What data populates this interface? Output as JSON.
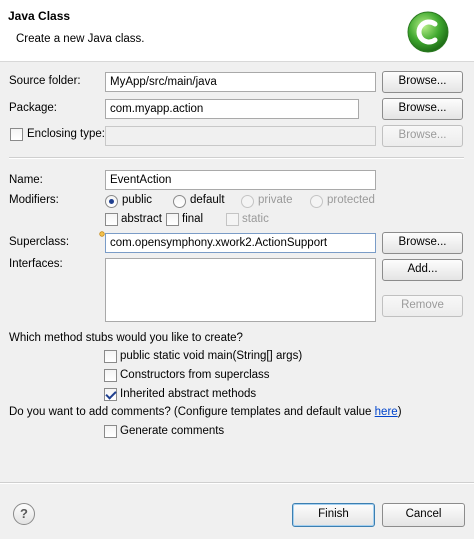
{
  "header": {
    "title": "Java Class",
    "description": "Create a new Java class."
  },
  "source_folder": {
    "label": "Source folder:",
    "value": "MyApp/src/main/java",
    "browse_label": "Browse..."
  },
  "package": {
    "label": "Package:",
    "value": "com.myapp.action",
    "browse_label": "Browse..."
  },
  "enclosing_type": {
    "label": "Enclosing type:",
    "value": "",
    "browse_label": "Browse...",
    "checked": false
  },
  "name": {
    "label": "Name:",
    "value": "EventAction"
  },
  "modifiers": {
    "label": "Modifiers:",
    "public_label": "public",
    "default_label": "default",
    "private_label": "private",
    "protected_label": "protected",
    "abstract_label": "abstract",
    "final_label": "final",
    "static_label": "static"
  },
  "superclass": {
    "label": "Superclass:",
    "value": "com.opensymphony.xwork2.ActionSupport",
    "browse_label": "Browse..."
  },
  "interfaces": {
    "label": "Interfaces:",
    "add_label": "Add...",
    "remove_label": "Remove"
  },
  "stubs": {
    "question": "Which method stubs would you like to create?",
    "main_label": "public static void main(String[] args)",
    "constructors_label": "Constructors from superclass",
    "inherited_label": "Inherited abstract methods"
  },
  "comments": {
    "question": "Do you want to add comments? (Configure templates and default value ",
    "link_text": "here",
    "question_end": ")",
    "generate_label": "Generate comments"
  },
  "footer": {
    "help_symbol": "?",
    "finish_label": "Finish",
    "cancel_label": "Cancel"
  },
  "icons": [
    "class-wizard-logo-icon",
    "content-assist-icon",
    "help-icon"
  ],
  "colors": {
    "logo_green": "#3fa82f",
    "dialog_bg": "#f0f0f0",
    "link": "#0044cc"
  }
}
